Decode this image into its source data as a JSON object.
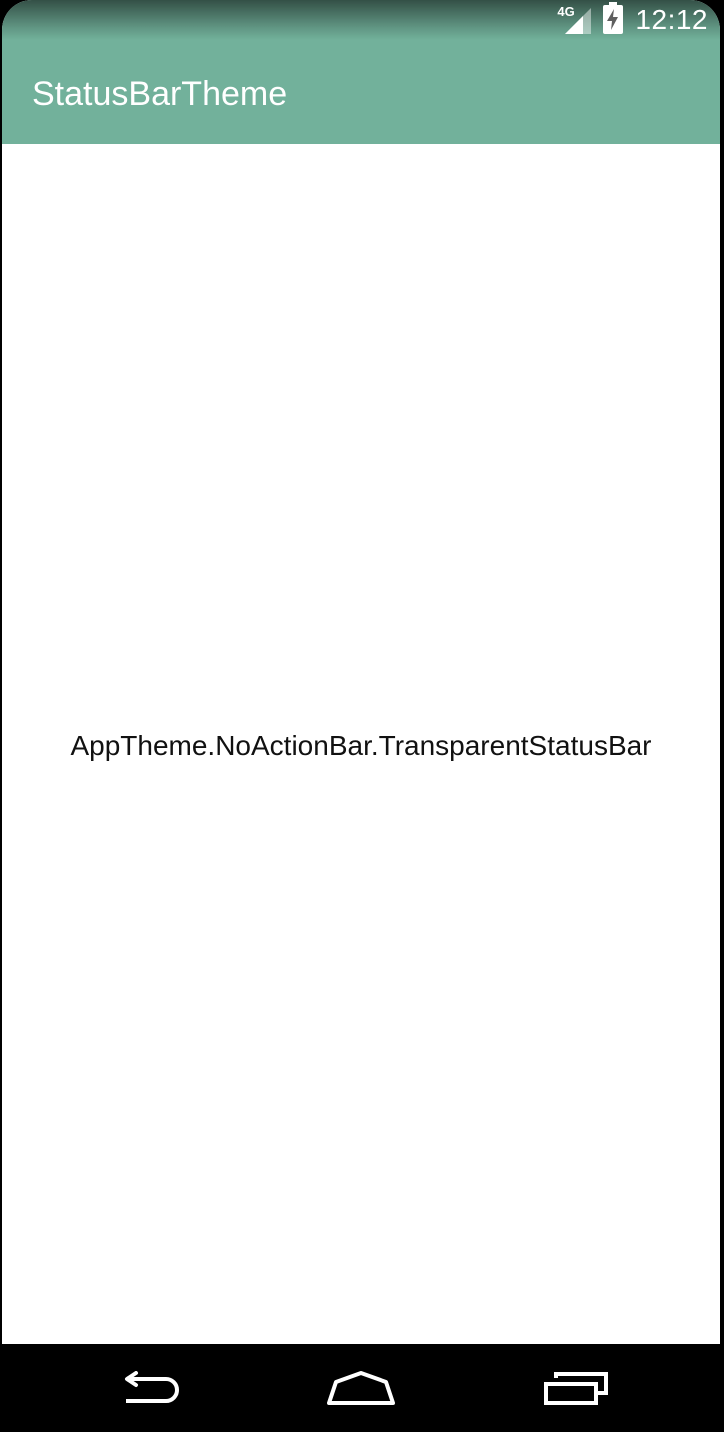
{
  "status_bar": {
    "network_type": "4G",
    "time": "12:12",
    "icons": [
      "signal-icon",
      "battery-charging-icon"
    ]
  },
  "app_bar": {
    "title": "StatusBarTheme",
    "color": "#72b19b"
  },
  "content": {
    "label": "AppTheme.NoActionBar.TransparentStatusBar"
  },
  "nav_bar": {
    "buttons": [
      "back-icon",
      "home-icon",
      "recents-icon"
    ]
  }
}
